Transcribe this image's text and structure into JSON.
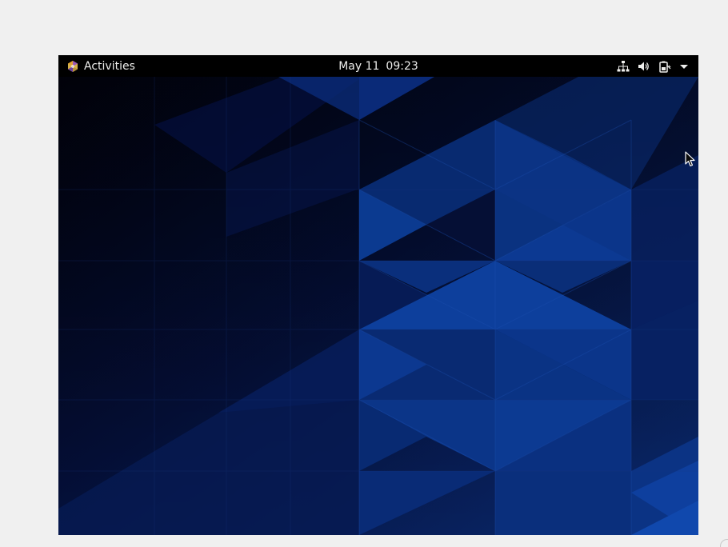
{
  "topbar": {
    "activities_label": "Activities",
    "clock": {
      "date": "May 11",
      "time": "09:23"
    },
    "status_icons": [
      "network-wired-icon",
      "volume-icon",
      "battery-icon",
      "chevron-down-icon"
    ]
  },
  "colors": {
    "panel": "#000000",
    "panel_text": "#eeeeec",
    "wallpaper_dark": "#02061e",
    "wallpaper_blue": "#0a3c8c",
    "host_background": "#f0f0f0"
  }
}
